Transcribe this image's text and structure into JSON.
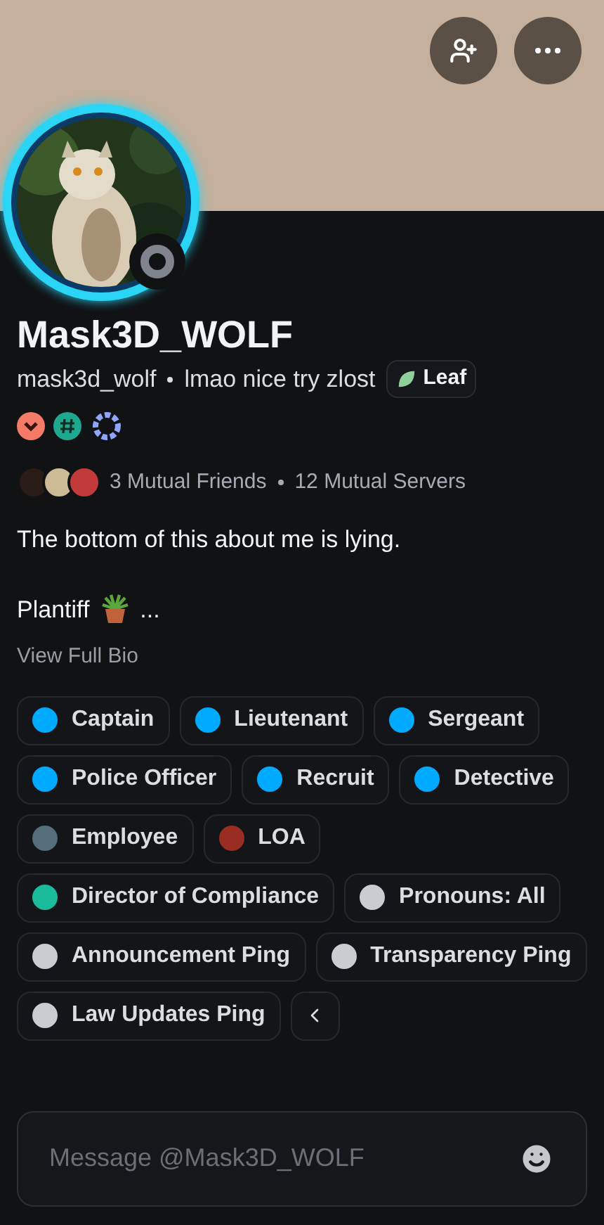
{
  "profile": {
    "display_name": "Mask3D_WOLF",
    "username": "mask3d_wolf",
    "custom_status": "lmao nice try zlost",
    "tag": "Leaf",
    "offline": true
  },
  "mutuals": {
    "friends": "3 Mutual Friends",
    "servers": "12 Mutual Servers"
  },
  "bio": {
    "line_1": "The bottom of this about me is lying.",
    "line_2": "Plantiff",
    "line_2_end": "...",
    "link": "View Full Bio"
  },
  "roles": [
    {
      "name": "Captain",
      "color": "#00aaff"
    },
    {
      "name": "Lieutenant",
      "color": "#00aaff"
    },
    {
      "name": "Sergeant",
      "color": "#00aaff"
    },
    {
      "name": "Police Officer",
      "color": "#00aaff"
    },
    {
      "name": "Recruit",
      "color": "#00aaff"
    },
    {
      "name": "Detective",
      "color": "#00aaff"
    },
    {
      "name": "Employee",
      "color": "#546e7a"
    },
    {
      "name": "LOA",
      "color": "#992d22"
    },
    {
      "name": "Director of Compliance",
      "color": "#1abc9c"
    },
    {
      "name": "Pronouns: All",
      "color": "#c9cdd2"
    },
    {
      "name": "Announcement Ping",
      "color": "#c9cdd2"
    },
    {
      "name": "Transparency Ping",
      "color": "#c9cdd2"
    },
    {
      "name": "Law Updates Ping",
      "color": "#c9cdd2"
    }
  ],
  "message": {
    "placeholder": "Message @Mask3D_WOLF"
  }
}
